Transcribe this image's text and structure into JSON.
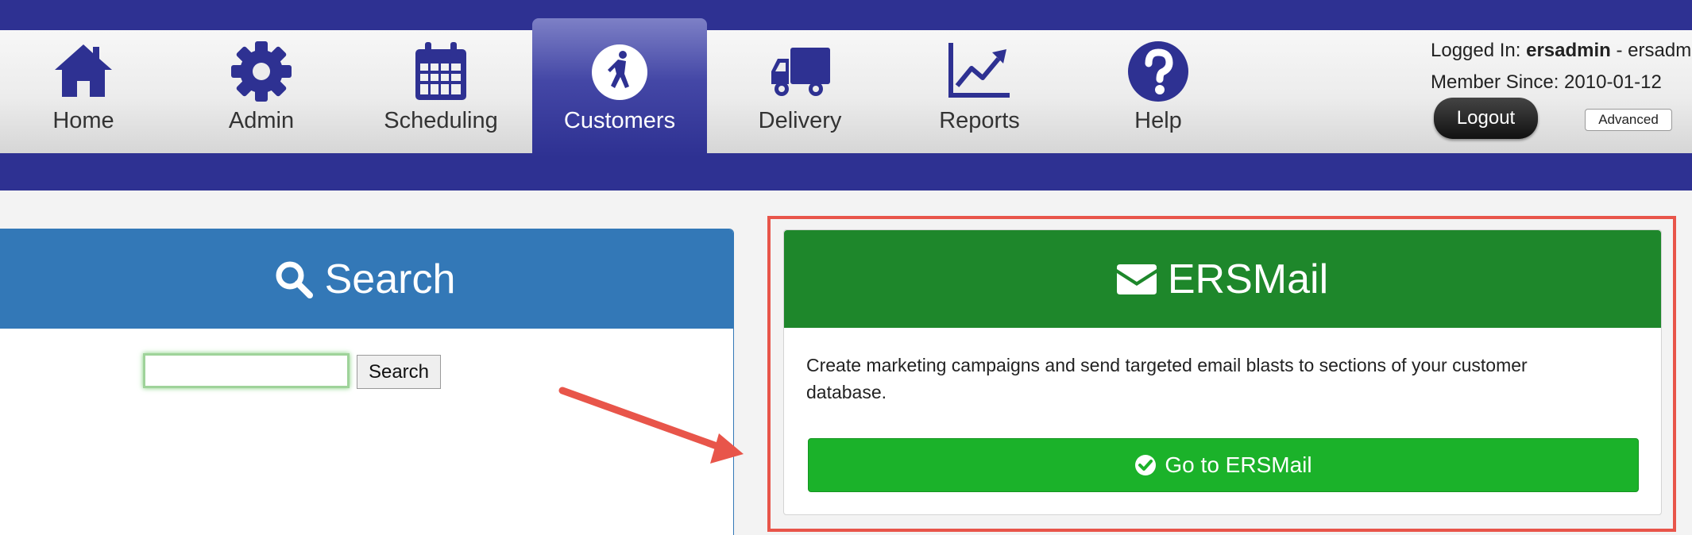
{
  "nav": {
    "items": [
      {
        "label": "Home",
        "icon": "home-icon"
      },
      {
        "label": "Admin",
        "icon": "gear-icon"
      },
      {
        "label": "Scheduling",
        "icon": "calendar-icon"
      },
      {
        "label": "Customers",
        "icon": "customer-icon",
        "active": true
      },
      {
        "label": "Delivery",
        "icon": "truck-icon"
      },
      {
        "label": "Reports",
        "icon": "chart-icon"
      },
      {
        "label": "Help",
        "icon": "help-icon"
      }
    ]
  },
  "user": {
    "logged_in_label": "Logged In: ",
    "username": "ersadmin",
    "name_suffix": " - ersadm",
    "member_since": "Member Since: 2010-01-12",
    "logout_label": "Logout",
    "advanced_label": "Advanced"
  },
  "search": {
    "title": "Search",
    "input_value": "",
    "button_label": "Search"
  },
  "ersmail": {
    "title": "ERSMail",
    "description": "Create marketing campaigns and send targeted email blasts to sections of your customer database.",
    "button_label": "Go to ERSMail"
  },
  "colors": {
    "nav_bar": "#2e3192",
    "search_header": "#3378b7",
    "ersmail_header": "#1e872b",
    "ersmail_button": "#1bb22a",
    "highlight": "#e8554a"
  }
}
